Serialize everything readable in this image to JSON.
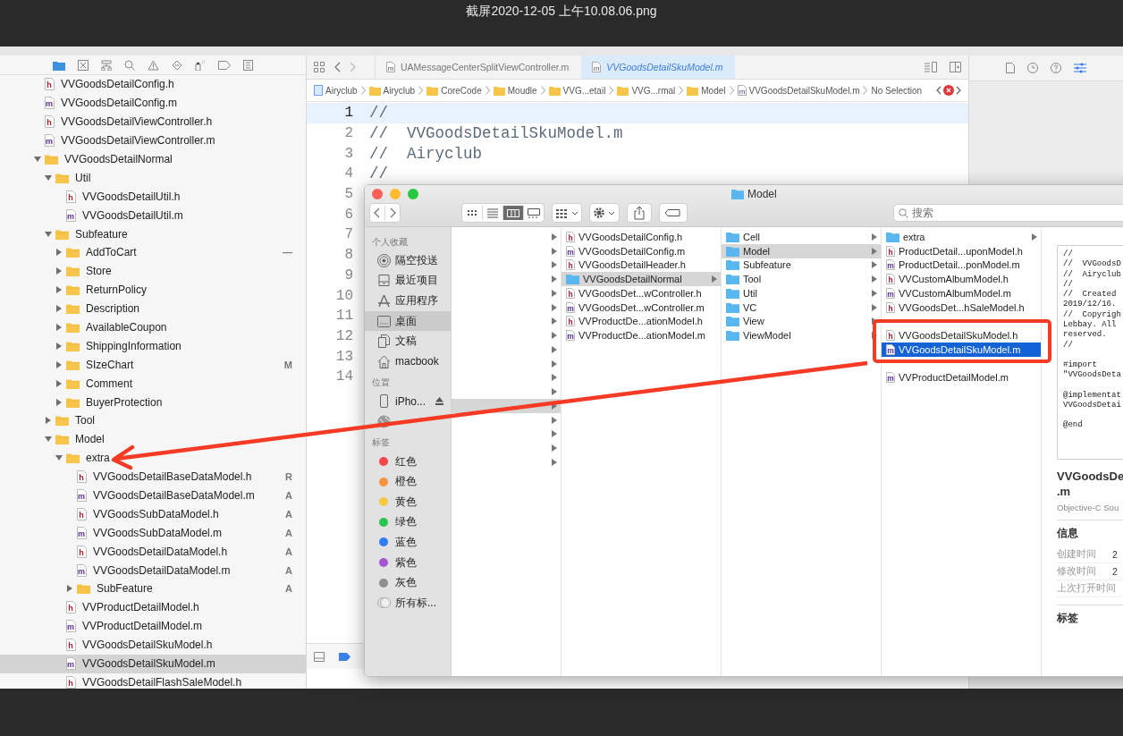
{
  "screenshot_title": "截屏2020-12-05 上午10.08.06.png",
  "xcode": {
    "tabs": [
      {
        "label": "UAMessageCenterSplitViewController.m",
        "icon": "m",
        "selected": false
      },
      {
        "label": "VVGoodsDetailSkuModel.m",
        "icon": "m",
        "selected": true
      }
    ],
    "jump_bar": [
      {
        "kind": "project",
        "label": "Airyclub"
      },
      {
        "kind": "folder",
        "label": "Airyclub"
      },
      {
        "kind": "folder",
        "label": "CoreCode"
      },
      {
        "kind": "folder",
        "label": "Moudle"
      },
      {
        "kind": "folder",
        "label": "VVG...etail"
      },
      {
        "kind": "folder",
        "label": "VVG...rmal"
      },
      {
        "kind": "folder",
        "label": "Model"
      },
      {
        "kind": "file",
        "icon": "m",
        "label": "VVGoodsDetailSkuModel.m"
      },
      {
        "kind": "none",
        "label": "No Selection"
      }
    ],
    "navigator": [
      {
        "kind": "file",
        "icon": "h",
        "name": "VVGoodsDetailConfig.h",
        "selected": false
      },
      {
        "kind": "file",
        "icon": "m",
        "name": "VVGoodsDetailConfig.m",
        "selected": false
      },
      {
        "kind": "file",
        "icon": "h",
        "name": "VVGoodsDetailViewController.h",
        "selected": false
      },
      {
        "kind": "file",
        "icon": "m",
        "name": "VVGoodsDetailViewController.m",
        "selected": false
      },
      {
        "kind": "folder",
        "name": "VVGoodsDetailNormal",
        "expanded": true,
        "selected": false,
        "children": [
          {
            "kind": "folder",
            "name": "Util",
            "expanded": true,
            "selected": false,
            "children": [
              {
                "kind": "file",
                "icon": "h",
                "name": "VVGoodsDetailUtil.h",
                "selected": false
              },
              {
                "kind": "file",
                "icon": "m",
                "name": "VVGoodsDetailUtil.m",
                "selected": false
              }
            ]
          },
          {
            "kind": "folder",
            "name": "Subfeature",
            "expanded": true,
            "selected": false,
            "children": [
              {
                "kind": "folder",
                "name": "AddToCart",
                "expanded": false,
                "selected": false,
                "badge": "—"
              },
              {
                "kind": "folder",
                "name": "Store",
                "expanded": false,
                "selected": false
              },
              {
                "kind": "folder",
                "name": "ReturnPolicy",
                "expanded": false,
                "selected": false
              },
              {
                "kind": "folder",
                "name": "Description",
                "expanded": false,
                "selected": false
              },
              {
                "kind": "folder",
                "name": "AvailableCoupon",
                "expanded": false,
                "selected": false
              },
              {
                "kind": "folder",
                "name": "ShippingInformation",
                "expanded": false,
                "selected": false
              },
              {
                "kind": "folder",
                "name": "SIzeChart",
                "expanded": false,
                "selected": false,
                "badge": "M"
              },
              {
                "kind": "folder",
                "name": "Comment",
                "expanded": false,
                "selected": false
              },
              {
                "kind": "folder",
                "name": "BuyerProtection",
                "expanded": false,
                "selected": false
              }
            ]
          },
          {
            "kind": "folder",
            "name": "Tool",
            "expanded": false,
            "selected": false
          },
          {
            "kind": "folder",
            "name": "Model",
            "expanded": true,
            "selected": false,
            "children": [
              {
                "kind": "folder",
                "name": "extra",
                "expanded": true,
                "selected": false,
                "children": [
                  {
                    "kind": "file",
                    "icon": "h",
                    "name": "VVGoodsDetailBaseDataModel.h",
                    "selected": false,
                    "badge": "R"
                  },
                  {
                    "kind": "file",
                    "icon": "m",
                    "name": "VVGoodsDetailBaseDataModel.m",
                    "selected": false,
                    "badge": "A"
                  },
                  {
                    "kind": "file",
                    "icon": "h",
                    "name": "VVGoodsSubDataModel.h",
                    "selected": false,
                    "badge": "A"
                  },
                  {
                    "kind": "file",
                    "icon": "m",
                    "name": "VVGoodsSubDataModel.m",
                    "selected": false,
                    "badge": "A"
                  },
                  {
                    "kind": "file",
                    "icon": "h",
                    "name": "VVGoodsDetailDataModel.h",
                    "selected": false,
                    "badge": "A"
                  },
                  {
                    "kind": "file",
                    "icon": "m",
                    "name": "VVGoodsDetailDataModel.m",
                    "selected": false,
                    "badge": "A"
                  },
                  {
                    "kind": "folder",
                    "name": "SubFeature",
                    "expanded": false,
                    "selected": false,
                    "badge": "A"
                  }
                ]
              },
              {
                "kind": "file",
                "icon": "h",
                "name": "VVProductDetailModel.h",
                "selected": false
              },
              {
                "kind": "file",
                "icon": "m",
                "name": "VVProductDetailModel.m",
                "selected": false
              },
              {
                "kind": "file",
                "icon": "h",
                "name": "VVGoodsDetailSkuModel.h",
                "selected": false
              },
              {
                "kind": "file",
                "icon": "m",
                "name": "VVGoodsDetailSkuModel.m",
                "selected": true
              },
              {
                "kind": "file",
                "icon": "h",
                "name": "VVGoodsDetailFlashSaleModel.h",
                "selected": false
              }
            ]
          }
        ]
      }
    ],
    "editor_lines": [
      {
        "number": "1",
        "code": "//",
        "current": true
      },
      {
        "number": "2",
        "code": "//  VVGoodsDetailSkuModel.m",
        "current": false
      },
      {
        "number": "3",
        "code": "//  Airyclub",
        "current": false
      },
      {
        "number": "4",
        "code": "//",
        "current": false
      },
      {
        "number": "5",
        "current": false
      },
      {
        "number": "6",
        "current": false
      },
      {
        "number": "7",
        "current": false
      },
      {
        "number": "8",
        "current": false
      },
      {
        "number": "9",
        "current": false
      },
      {
        "number": "10",
        "current": false
      },
      {
        "number": "11",
        "current": false
      },
      {
        "number": "12",
        "current": false
      },
      {
        "number": "13",
        "current": false
      },
      {
        "number": "14",
        "current": false
      }
    ]
  },
  "finder": {
    "title": "Model",
    "search": {
      "placeholder": "搜索"
    },
    "sidebar": [
      {
        "heading": "个人收藏",
        "items": [
          {
            "kind": "airdrop",
            "label": "隔空投送",
            "selected": false
          },
          {
            "kind": "recents",
            "label": "最近项目",
            "selected": false
          },
          {
            "kind": "apps",
            "label": "应用程序",
            "selected": false
          },
          {
            "kind": "desktop",
            "label": "桌面",
            "selected": true
          },
          {
            "kind": "documents",
            "label": "文稿",
            "selected": false
          },
          {
            "kind": "home",
            "label": "macbook",
            "selected": false
          }
        ]
      },
      {
        "heading": "位置",
        "items": [
          {
            "kind": "device",
            "label": "iPho...",
            "selected": false
          },
          {
            "kind": "network",
            "selected": false
          }
        ]
      },
      {
        "heading": "标签",
        "items": [
          {
            "kind": "tag",
            "label": "红色",
            "color": "#f4474b",
            "selected": false
          },
          {
            "kind": "tag",
            "label": "橙色",
            "color": "#f6923d",
            "selected": false
          },
          {
            "kind": "tag",
            "label": "黄色",
            "color": "#f7c843",
            "selected": false
          },
          {
            "kind": "tag",
            "label": "绿色",
            "color": "#2cc450",
            "selected": false
          },
          {
            "kind": "tag",
            "label": "蓝色",
            "color": "#2f7cf6",
            "selected": false
          },
          {
            "kind": "tag",
            "label": "紫色",
            "color": "#a557d3",
            "selected": false
          },
          {
            "kind": "tag",
            "label": "灰色",
            "color": "#8e8e90",
            "selected": false
          },
          {
            "kind": "all",
            "label": "所有标...",
            "selected": false
          }
        ]
      }
    ],
    "columns": [
      {
        "active": false,
        "rows": [
          {
            "kind": "folder",
            "selected": false
          },
          {
            "kind": "folder",
            "selected": false
          },
          {
            "kind": "folder",
            "selected": false
          },
          {
            "kind": "folder",
            "selected": false
          },
          {
            "kind": "folder",
            "selected": false
          },
          {
            "kind": "folder",
            "selected": false
          },
          {
            "kind": "folder",
            "selected": false
          },
          {
            "kind": "folder",
            "selected": false
          },
          {
            "kind": "folder",
            "selected": false
          },
          {
            "kind": "folder",
            "selected": false
          },
          {
            "kind": "folder",
            "selected": false
          },
          {
            "kind": "folder",
            "selected": false
          },
          {
            "kind": "folder",
            "selected": true
          },
          {
            "kind": "folder",
            "selected": false
          },
          {
            "kind": "folder",
            "selected": false
          },
          {
            "kind": "folder",
            "selected": false
          },
          {
            "kind": "folder",
            "selected": false
          }
        ]
      },
      {
        "active": false,
        "rows": [
          {
            "kind": "file",
            "icon": "h",
            "name": "VVGoodsDetailConfig.h",
            "selected": false
          },
          {
            "kind": "file",
            "icon": "m",
            "name": "VVGoodsDetailConfig.m",
            "selected": false
          },
          {
            "kind": "file",
            "icon": "h",
            "name": "VVGoodsDetailHeader.h",
            "selected": false
          },
          {
            "kind": "folder",
            "name": "VVGoodsDetailNormal",
            "selected": true
          },
          {
            "kind": "file",
            "icon": "h",
            "name": "VVGoodsDet...wController.h",
            "selected": false
          },
          {
            "kind": "file",
            "icon": "m",
            "name": "VVGoodsDet...wController.m",
            "selected": false
          },
          {
            "kind": "file",
            "icon": "h",
            "name": "VVProductDe...ationModel.h",
            "selected": false
          },
          {
            "kind": "file",
            "icon": "m",
            "name": "VVProductDe...ationModel.m",
            "selected": false
          }
        ]
      },
      {
        "active": false,
        "rows": [
          {
            "kind": "folder",
            "name": "Cell",
            "selected": false
          },
          {
            "kind": "folder",
            "name": "Model",
            "selected": true
          },
          {
            "kind": "folder",
            "name": "Subfeature",
            "selected": false
          },
          {
            "kind": "folder",
            "name": "Tool",
            "selected": false
          },
          {
            "kind": "folder",
            "name": "Util",
            "selected": false
          },
          {
            "kind": "folder",
            "name": "VC",
            "selected": false
          },
          {
            "kind": "folder",
            "name": "View",
            "selected": false
          },
          {
            "kind": "folder",
            "name": "ViewModel",
            "selected": false
          }
        ]
      },
      {
        "active": true,
        "rows": [
          {
            "kind": "folder",
            "name": "extra",
            "selected": false
          },
          {
            "kind": "file",
            "icon": "h",
            "name": "ProductDetail...uponModel.h",
            "selected": false
          },
          {
            "kind": "file",
            "icon": "m",
            "name": "ProductDetail...ponModel.m",
            "selected": false
          },
          {
            "kind": "file",
            "icon": "h",
            "name": "VVCustomAlbumModel.h",
            "selected": false
          },
          {
            "kind": "file",
            "icon": "m",
            "name": "VVCustomAlbumModel.m",
            "selected": false
          },
          {
            "kind": "file",
            "icon": "h",
            "name": "VVGoodsDet...hSaleModel.h",
            "selected": false
          },
          {
            "kind": "file"
          },
          {
            "kind": "file",
            "icon": "h",
            "name": "VVGoodsDetailSkuModel.h",
            "selected": false
          },
          {
            "kind": "file",
            "icon": "m",
            "name": "VVGoodsDetailSkuModel.m",
            "selected": true
          },
          {
            "kind": "file"
          },
          {
            "kind": "file",
            "icon": "m",
            "name": "VVProductDetailModel.m",
            "selected": false
          }
        ]
      }
    ],
    "preview": {
      "code_blocks": [
        [
          "//",
          "//  VVGoodsD",
          "//  Airyclub",
          "//",
          "//  Created",
          "2019/12/16.",
          "//  Copyrigh",
          "Lebbay. All",
          "reserved.",
          "//"
        ],
        [
          "#import",
          "\"VVGoodsDeta"
        ],
        [
          "@implementat",
          "VVGoodsDetai"
        ],
        [
          "@end"
        ]
      ],
      "title_lines": [
        "VVGoodsDe",
        ".m"
      ],
      "file_type": "Objective-C Sou",
      "info_heading": "信息",
      "info_rows": [
        {
          "label": "创建时间",
          "value": "2"
        },
        {
          "label": "修改时间",
          "value": "2"
        },
        {
          "label": "上次打开时间"
        }
      ],
      "tags_heading": "标签"
    }
  }
}
